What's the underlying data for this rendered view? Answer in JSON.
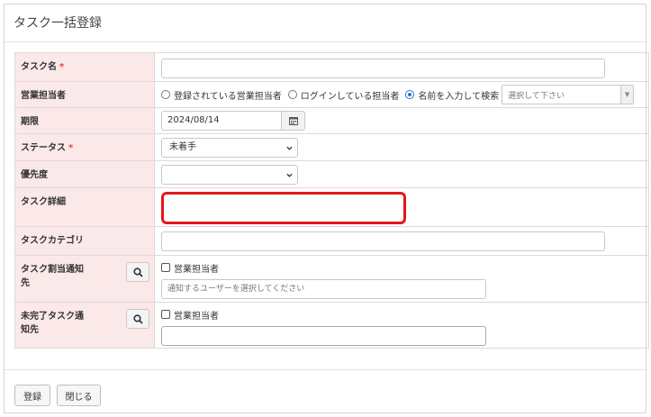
{
  "panel": {
    "title": "タスク一括登録"
  },
  "form": {
    "task_name": {
      "label": "タスク名",
      "required_mark": "*",
      "value": ""
    },
    "sales_owner": {
      "label": "営業担当者",
      "options": [
        {
          "label": "登録されている営業担当者",
          "checked": false
        },
        {
          "label": "ログインしている担当者",
          "checked": false
        },
        {
          "label": "名前を入力して検索",
          "checked": true
        }
      ],
      "combo_placeholder": "選択して下さい"
    },
    "deadline": {
      "label": "期限",
      "value": "2024/08/14"
    },
    "status": {
      "label": "ステータス",
      "required_mark": "*",
      "value": "未着手"
    },
    "priority": {
      "label": "優先度",
      "value": ""
    },
    "task_detail": {
      "label": "タスク詳細",
      "value": ""
    },
    "task_category": {
      "label": "タスクカテゴリ",
      "value": ""
    },
    "task_notify": {
      "label_line1": "タスク割当通知",
      "label_line2": "先",
      "checkbox_label": "営業担当者",
      "placeholder": "通知するユーザーを選択してください"
    },
    "incomplete_notify": {
      "label_line1": "未完了タスク通",
      "label_line2": "知先",
      "checkbox_label": "営業担当者",
      "value": ""
    }
  },
  "footer": {
    "register_label": "登録",
    "close_label": "閉じる"
  }
}
